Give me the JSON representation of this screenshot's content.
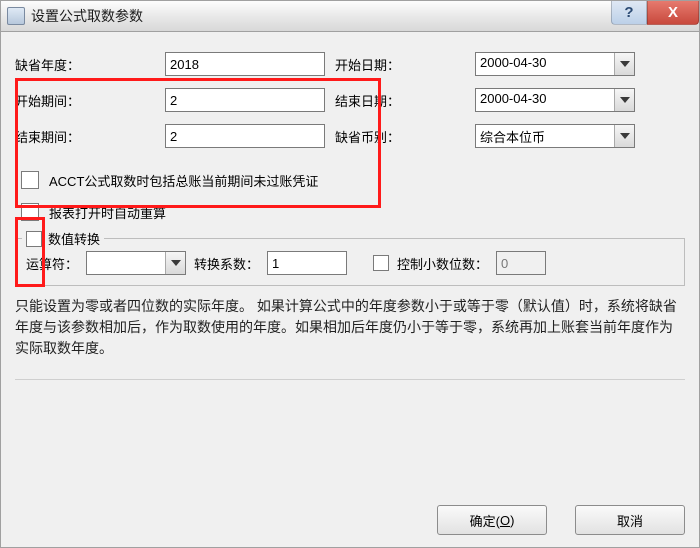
{
  "window": {
    "title": "设置公式取数参数",
    "help_glyph": "?",
    "close_glyph": "X"
  },
  "fields": {
    "default_year": {
      "label": "缺省年度：",
      "value": "2018"
    },
    "start_date": {
      "label": "开始日期：",
      "value": "2000-04-30"
    },
    "start_period": {
      "label": "开始期间：",
      "value": "2"
    },
    "end_date": {
      "label": "结束日期：",
      "value": "2000-04-30"
    },
    "end_period": {
      "label": "结束期间：",
      "value": "2"
    },
    "default_currency": {
      "label": "缺省币别：",
      "value": "综合本位币"
    }
  },
  "checkboxes": {
    "acct": "ACCT公式取数时包括总账当前期间未过账凭证",
    "auto_recalc": "报表打开时自动重算"
  },
  "group": {
    "title": "数值转换",
    "operator_label": "运算符：",
    "operator_value": "",
    "factor_label": "转换系数：",
    "factor_value": "1",
    "decimals_label": "控制小数位数：",
    "decimals_value": "0"
  },
  "help_text": "只能设置为零或者四位数的实际年度。 如果计算公式中的年度参数小于或等于零（默认值）时，系统将缺省年度与该参数相加后，作为取数使用的年度。如果相加后年度仍小于等于零，系统再加上账套当前年度作为实际取数年度。",
  "buttons": {
    "ok_prefix": "确定(",
    "ok_hotkey": "O",
    "ok_suffix": ")",
    "cancel": "取消"
  }
}
